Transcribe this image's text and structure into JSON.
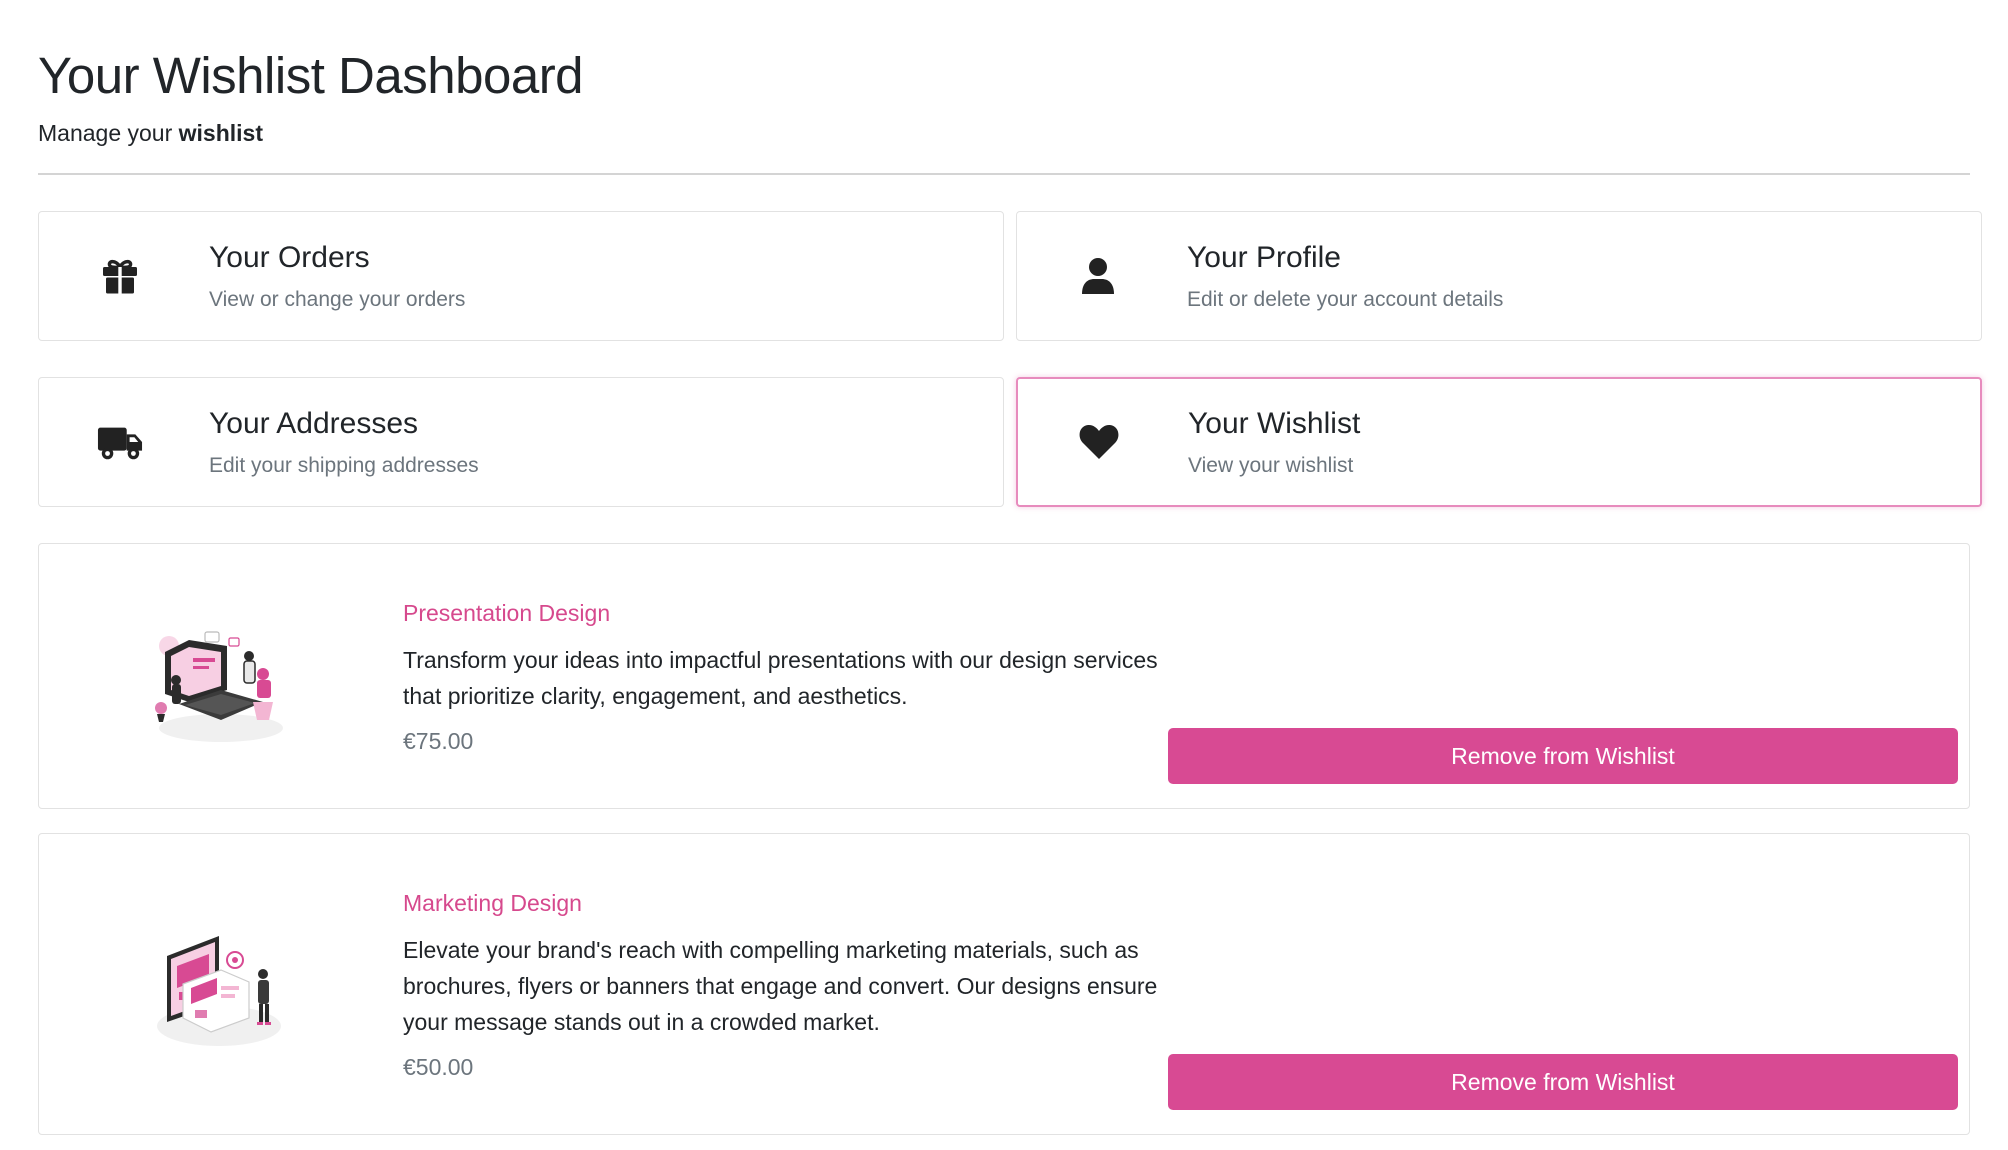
{
  "header": {
    "title": "Your Wishlist Dashboard",
    "subtitle_prefix": "Manage your ",
    "subtitle_bold": "wishlist"
  },
  "cards": [
    {
      "icon": "gift-icon",
      "title": "Your Orders",
      "description": "View or change your orders"
    },
    {
      "icon": "user-icon",
      "title": "Your Profile",
      "description": "Edit or delete your account details"
    },
    {
      "icon": "truck-icon",
      "title": "Your Addresses",
      "description": "Edit your shipping addresses"
    },
    {
      "icon": "heart-icon",
      "title": "Your Wishlist",
      "description": "View your wishlist",
      "active": true
    }
  ],
  "wishlist": [
    {
      "title": "Presentation Design",
      "description": "Transform your ideas into impactful presentations with our design services that prioritize clarity, engagement, and aesthetics.",
      "price": "€75.00",
      "button": "Remove from Wishlist"
    },
    {
      "title": "Marketing Design",
      "description": "Elevate your brand's reach with compelling marketing materials, such as brochures, flyers or banners that engage and convert. Our designs ensure your message stands out in a crowded market.",
      "price": "€50.00",
      "button": "Remove from Wishlist"
    }
  ],
  "colors": {
    "accent": "#d84a93",
    "active_border": "#e78bbd",
    "muted_text": "#6c757d"
  }
}
